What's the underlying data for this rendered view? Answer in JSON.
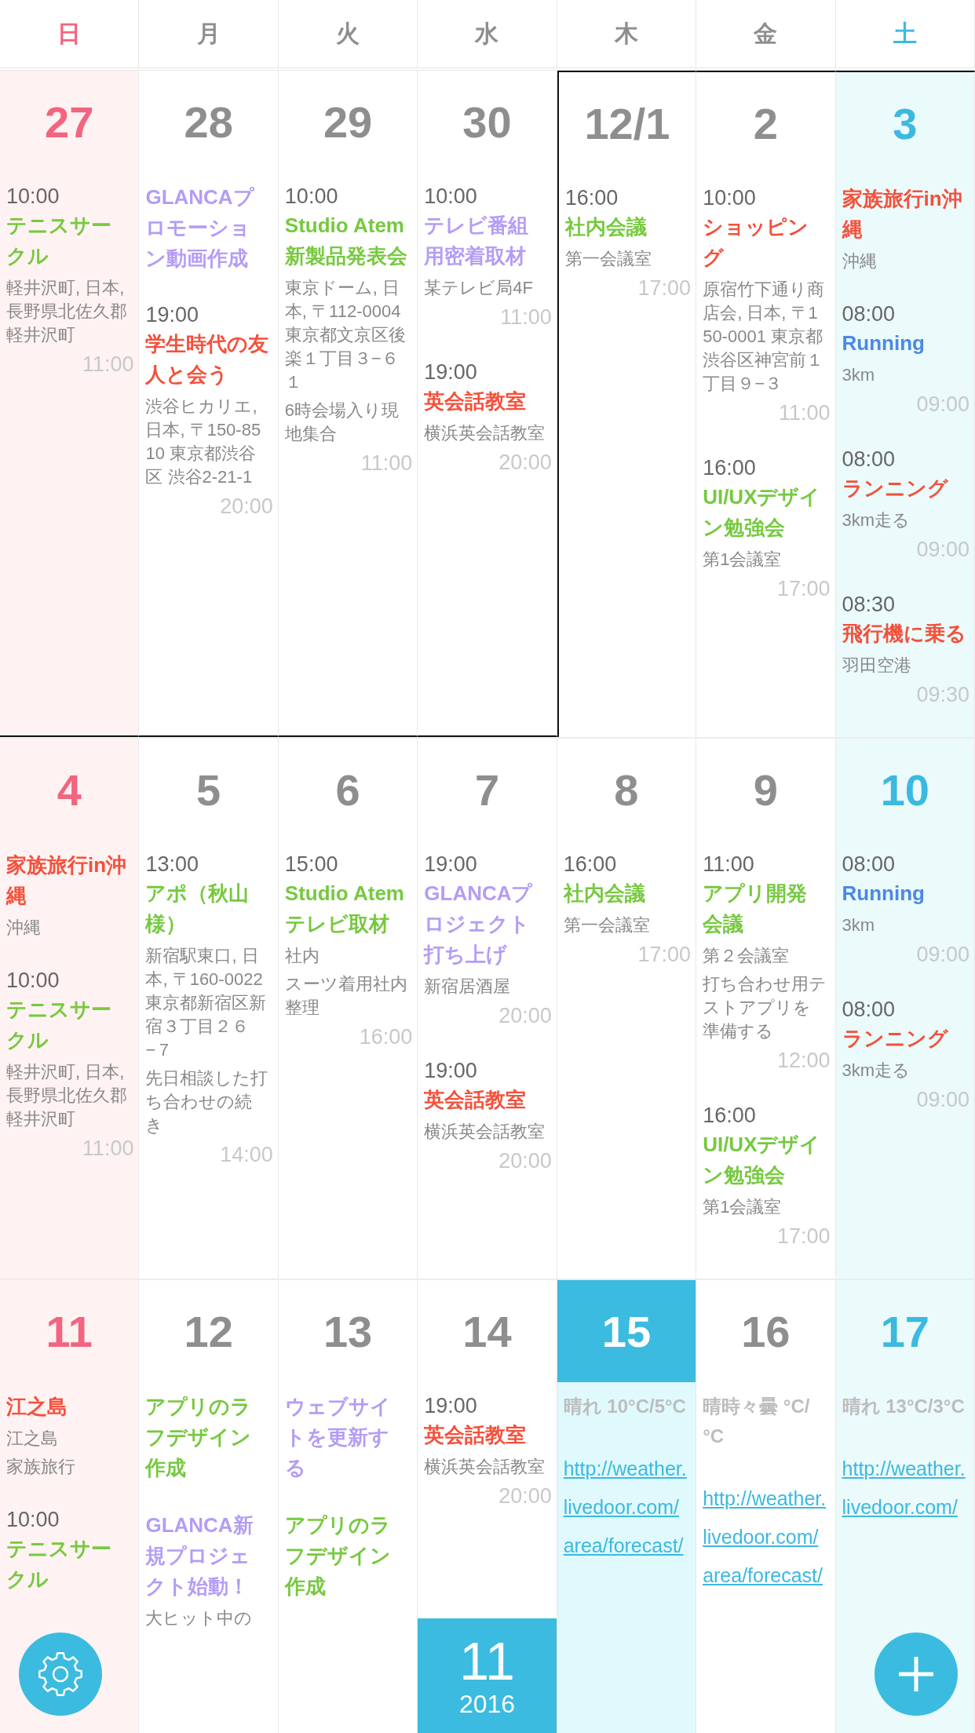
{
  "weekdays": [
    {
      "label": "日",
      "kind": "sunday"
    },
    {
      "label": "月",
      "kind": "weekday"
    },
    {
      "label": "火",
      "kind": "weekday"
    },
    {
      "label": "水",
      "kind": "weekday"
    },
    {
      "label": "木",
      "kind": "weekday"
    },
    {
      "label": "金",
      "kind": "weekday"
    },
    {
      "label": "土",
      "kind": "saturday"
    }
  ],
  "weeks": [
    {
      "days": [
        {
          "number": "27",
          "selected": false,
          "prev_month": true,
          "events": [
            {
              "kind": "event",
              "start": "10:00",
              "title": "テニスサークル",
              "color": "#76c93f",
              "notes": [
                "軽井沢町, 日本, 長野県北佐久郡軽井沢町"
              ],
              "end": "11:00"
            }
          ]
        },
        {
          "number": "28",
          "selected": false,
          "prev_month": true,
          "events": [
            {
              "kind": "event",
              "title": "GLANCAプロモーション動画作成",
              "color": "#b49cf6"
            },
            {
              "kind": "event",
              "start": "19:00",
              "title": "学生時代の友人と会う",
              "color": "#f4503b",
              "notes": [
                "渋谷ヒカリエ, 日本, 〒150-8510 東京都渋谷区 渋谷2-21-1"
              ],
              "end": "20:00"
            }
          ]
        },
        {
          "number": "29",
          "selected": false,
          "prev_month": true,
          "events": [
            {
              "kind": "event",
              "start": "10:00",
              "title": "Studio Atem新製品発表会",
              "color": "#76c93f",
              "notes": [
                "東京ドーム, 日本, 〒112-0004 東京都文京区後楽１丁目３−６１",
                "6時会場入り現地集合"
              ],
              "end": "11:00"
            }
          ]
        },
        {
          "number": "30",
          "selected": false,
          "prev_month": true,
          "events": [
            {
              "kind": "event",
              "start": "10:00",
              "title": "テレビ番組用密着取材",
              "color": "#b49cf6",
              "notes": [
                "某テレビ局4F"
              ],
              "end": "11:00"
            },
            {
              "kind": "event",
              "start": "19:00",
              "title": "英会話教室",
              "color": "#f4503b",
              "notes": [
                "横浜英会話教室"
              ],
              "end": "20:00"
            }
          ]
        },
        {
          "number": "12/1",
          "selected": false,
          "prev_month": false,
          "events": [
            {
              "kind": "event",
              "start": "16:00",
              "title": "社内会議",
              "color": "#76c93f",
              "notes": [
                "第一会議室"
              ],
              "end": "17:00"
            }
          ]
        },
        {
          "number": "2",
          "selected": false,
          "prev_month": false,
          "events": [
            {
              "kind": "event",
              "start": "10:00",
              "title": "ショッピング",
              "color": "#f4503b",
              "notes": [
                "原宿竹下通り商店会, 日本, 〒150-0001 東京都渋谷区神宮前１丁目９−３"
              ],
              "end": "11:00"
            },
            {
              "kind": "event",
              "start": "16:00",
              "title": "UI/UXデザイン勉強会",
              "color": "#76c93f",
              "notes": [
                "第1会議室"
              ],
              "end": "17:00"
            }
          ]
        },
        {
          "number": "3",
          "selected": false,
          "prev_month": false,
          "events": [
            {
              "kind": "event",
              "title": "家族旅行in沖縄",
              "color": "#f4503b",
              "notes": [
                "沖縄"
              ]
            },
            {
              "kind": "event",
              "start": "08:00",
              "title": "Running",
              "color": "#4a89e6",
              "notes": [
                "3km"
              ],
              "end": "09:00"
            },
            {
              "kind": "event",
              "start": "08:00",
              "title": "ランニング",
              "color": "#f4503b",
              "notes": [
                "3km走る"
              ],
              "end": "09:00"
            },
            {
              "kind": "event",
              "start": "08:30",
              "title": "飛行機に乗る",
              "color": "#f4503b",
              "notes": [
                "羽田空港"
              ],
              "end": "09:30"
            }
          ]
        }
      ]
    },
    {
      "days": [
        {
          "number": "4",
          "selected": false,
          "prev_month": false,
          "events": [
            {
              "kind": "event",
              "title": "家族旅行in沖縄",
              "color": "#f4503b",
              "notes": [
                "沖縄"
              ]
            },
            {
              "kind": "event",
              "start": "10:00",
              "title": "テニスサークル",
              "color": "#76c93f",
              "notes": [
                "軽井沢町, 日本, 長野県北佐久郡軽井沢町"
              ],
              "end": "11:00"
            }
          ]
        },
        {
          "number": "5",
          "selected": false,
          "prev_month": false,
          "events": [
            {
              "kind": "event",
              "start": "13:00",
              "title": "アポ（秋山様）",
              "color": "#76c93f",
              "notes": [
                "新宿駅東口, 日本, 〒160-0022 東京都新宿区新宿３丁目２６−７",
                "先日相談した打ち合わせの続き"
              ],
              "end": "14:00"
            }
          ]
        },
        {
          "number": "6",
          "selected": false,
          "prev_month": false,
          "events": [
            {
              "kind": "event",
              "start": "15:00",
              "title": "Studio Atemテレビ取材",
              "color": "#76c93f",
              "notes": [
                "社内",
                "スーツ着用社内整理"
              ],
              "end": "16:00"
            }
          ]
        },
        {
          "number": "7",
          "selected": false,
          "prev_month": false,
          "events": [
            {
              "kind": "event",
              "start": "19:00",
              "title": "GLANCAプロジェクト打ち上げ",
              "color": "#b49cf6",
              "notes": [
                "新宿居酒屋"
              ],
              "end": "20:00"
            },
            {
              "kind": "event",
              "start": "19:00",
              "title": "英会話教室",
              "color": "#f4503b",
              "notes": [
                "横浜英会話教室"
              ],
              "end": "20:00"
            }
          ]
        },
        {
          "number": "8",
          "selected": false,
          "prev_month": false,
          "events": [
            {
              "kind": "event",
              "start": "16:00",
              "title": "社内会議",
              "color": "#76c93f",
              "notes": [
                "第一会議室"
              ],
              "end": "17:00"
            }
          ]
        },
        {
          "number": "9",
          "selected": false,
          "prev_month": false,
          "events": [
            {
              "kind": "event",
              "start": "11:00",
              "title": "アプリ開発会議",
              "color": "#76c93f",
              "notes": [
                "第２会議室",
                "打ち合わせ用テストアプリを準備する"
              ],
              "end": "12:00"
            },
            {
              "kind": "event",
              "start": "16:00",
              "title": "UI/UXデザイン勉強会",
              "color": "#76c93f",
              "notes": [
                "第1会議室"
              ],
              "end": "17:00"
            }
          ]
        },
        {
          "number": "10",
          "selected": false,
          "prev_month": false,
          "events": [
            {
              "kind": "event",
              "start": "08:00",
              "title": "Running",
              "color": "#4a89e6",
              "notes": [
                "3km"
              ],
              "end": "09:00"
            },
            {
              "kind": "event",
              "start": "08:00",
              "title": "ランニング",
              "color": "#f4503b",
              "notes": [
                "3km走る"
              ],
              "end": "09:00"
            }
          ]
        }
      ]
    },
    {
      "days": [
        {
          "number": "11",
          "selected": false,
          "prev_month": false,
          "events": [
            {
              "kind": "event",
              "title": "江之島",
              "color": "#f4503b",
              "notes": [
                "江之島",
                "家族旅行"
              ]
            },
            {
              "kind": "event",
              "start": "10:00",
              "title": "テニスサークル",
              "color": "#76c93f"
            }
          ]
        },
        {
          "number": "12",
          "selected": false,
          "prev_month": false,
          "events": [
            {
              "kind": "event",
              "title": "アプリのラフデザイン作成",
              "color": "#76c93f"
            },
            {
              "kind": "event",
              "title": "GLANCA新規プロジェクト始動！",
              "color": "#b49cf6",
              "notes": [
                "大ヒット中の"
              ]
            }
          ]
        },
        {
          "number": "13",
          "selected": false,
          "prev_month": false,
          "events": [
            {
              "kind": "event",
              "title": "ウェブサイトを更新する",
              "color": "#b49cf6"
            },
            {
              "kind": "event",
              "title": "アプリのラフデザイン作成",
              "color": "#76c93f"
            }
          ]
        },
        {
          "number": "14",
          "selected": false,
          "prev_month": false,
          "month_badge": {
            "month": "11",
            "year": "2016"
          },
          "events": [
            {
              "kind": "event",
              "start": "19:00",
              "title": "英会話教室",
              "color": "#f4503b",
              "notes": [
                "横浜英会話教室"
              ],
              "end": "20:00"
            }
          ]
        },
        {
          "number": "15",
          "selected": true,
          "prev_month": false,
          "events": [
            {
              "kind": "weather",
              "title": "晴れ 10°C/5°C",
              "link": "http://weather.livedoor.com/area/forecast/"
            }
          ]
        },
        {
          "number": "16",
          "selected": false,
          "prev_month": false,
          "events": [
            {
              "kind": "weather",
              "title": "晴時々曇 °C/°C",
              "link": "http://weather.livedoor.com/area/forecast/"
            }
          ]
        },
        {
          "number": "17",
          "selected": false,
          "prev_month": false,
          "events": [
            {
              "kind": "weather",
              "title": "晴れ 13°C/3°C",
              "link": "http://weather.livedoor.com/"
            }
          ]
        }
      ]
    }
  ]
}
